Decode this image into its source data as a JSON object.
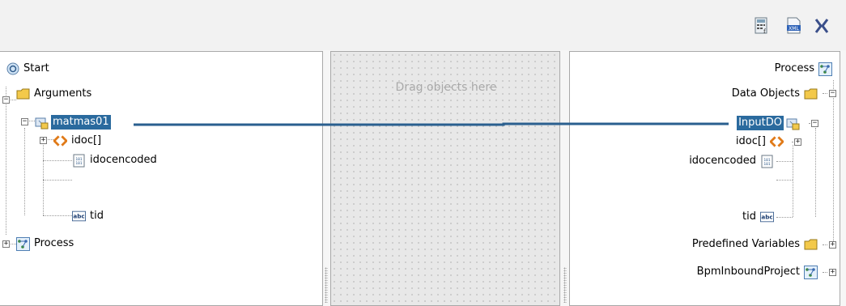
{
  "toolbar": {
    "buttons": [
      {
        "icon": "calculator-icon",
        "label": ""
      },
      {
        "icon": "xml-icon",
        "label": "XML"
      },
      {
        "icon": "collapse-icon",
        "label": ""
      }
    ]
  },
  "left_tree": {
    "start": "Start",
    "arguments": "Arguments",
    "matmas": "matmas01",
    "idoc": "idoc[]",
    "idocencoded": "idocencoded",
    "tid": "tid",
    "process": "Process"
  },
  "middle": {
    "drag_hint": "Drag objects here"
  },
  "right_tree": {
    "process": "Process",
    "data_objects": "Data Objects",
    "inputdo": "InputDO",
    "idoc": "idoc[]",
    "idocencoded": "idocencoded",
    "tid": "tid",
    "predefined": "Predefined Variables",
    "bpm": "BpmInboundProject"
  },
  "icon_text": {
    "abc": "abc",
    "binary": "101"
  },
  "colors": {
    "selection": "#2a6a9e",
    "connector": "#2a5f8f",
    "folder": "#e8b93a",
    "idoc": "#e07a18"
  }
}
